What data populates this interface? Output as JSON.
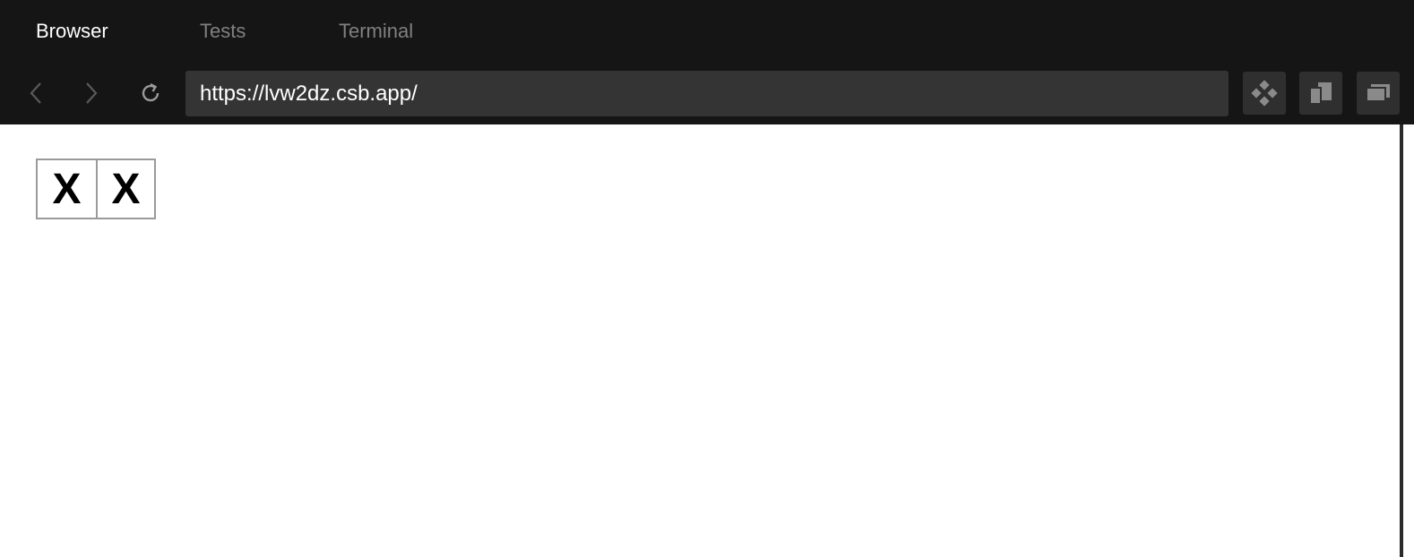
{
  "tabs": [
    {
      "label": "Browser",
      "active": true
    },
    {
      "label": "Tests",
      "active": false
    },
    {
      "label": "Terminal",
      "active": false
    }
  ],
  "navbar": {
    "url": "https://lvw2dz.csb.app/",
    "icons": {
      "back": "chevron-left-icon",
      "forward": "chevron-right-icon",
      "reload": "reload-icon",
      "devtools": "devtools-diamond-icon",
      "split": "split-view-icon",
      "window": "open-window-icon"
    }
  },
  "board": {
    "cells": [
      "X",
      "X"
    ]
  },
  "colors": {
    "chrome_bg": "#151515",
    "url_bg": "#343434",
    "tab_active": "#ffffff",
    "tab_inactive": "#808080",
    "icon_gray": "#8a8a8a"
  }
}
